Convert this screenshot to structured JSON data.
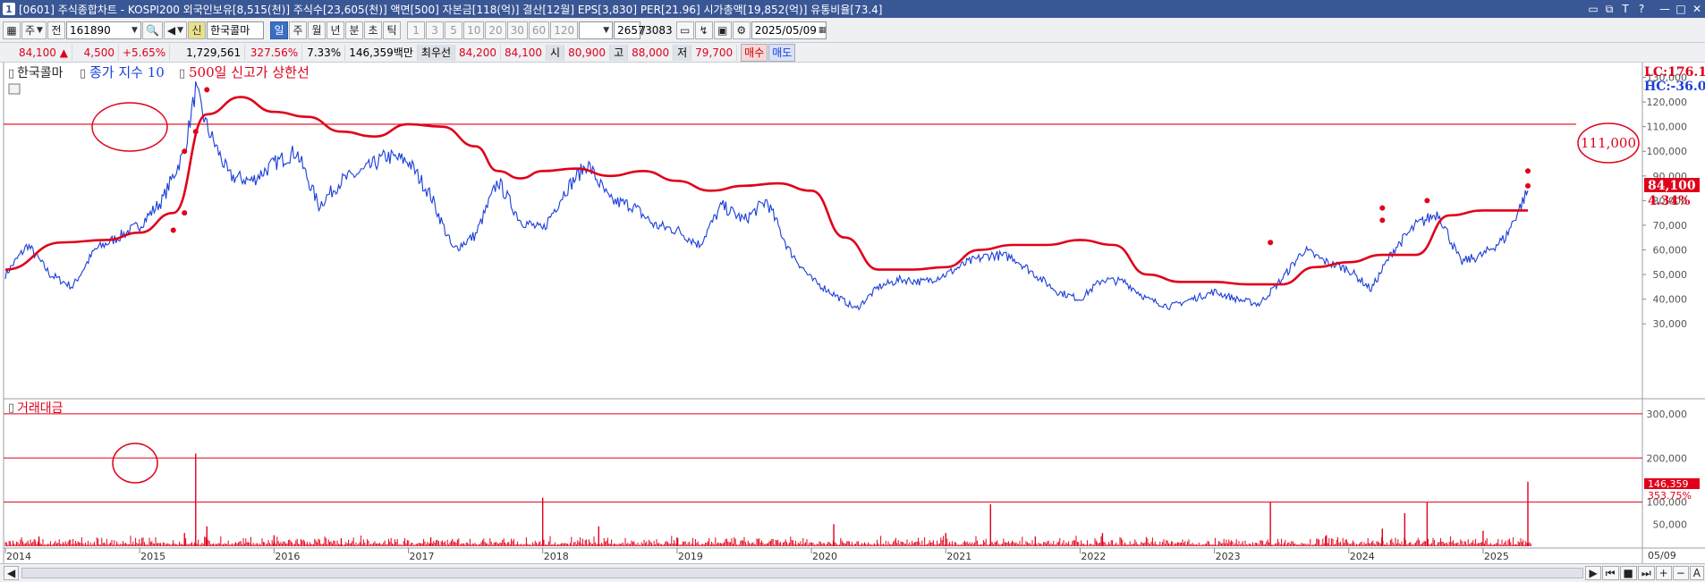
{
  "window": {
    "title": "[0601] 주식종합차트 - KOSPI200 외국인보유[8,515(천)] 주식수[23,605(천)] 액면[500] 자본금[118(억)] 결산[12월] EPS[3,830] PER[21.96] 시가총액[19,852(억)] 유통비율[73.4]",
    "badge": "1",
    "controls": [
      "▭",
      "⧉",
      "T",
      "?",
      "—",
      "□",
      "✕"
    ]
  },
  "toolbar": {
    "period_label": "주",
    "jeon_label": "전",
    "code_value": "161890",
    "name_label": "한국콜마",
    "sin_badge": "신",
    "periods": [
      "일",
      "주",
      "월",
      "년",
      "분",
      "초",
      "틱"
    ],
    "active_period": "일",
    "minute_options": [
      "1",
      "3",
      "5",
      "10",
      "20",
      "30",
      "60",
      "120"
    ],
    "count_value": "2657",
    "count_total": "/3083",
    "date_value": "2025/05/09"
  },
  "quote": {
    "price": "84,100",
    "change_arrow": "▲",
    "change": "4,500",
    "change_pct": "+5.65%",
    "volume": "1,729,561",
    "volume_ratio": "327.56%",
    "turnover": "7.33%",
    "amount": "146,359백만",
    "prior_label": "최우선",
    "prior_ask": "84,200",
    "prior_bid": "84,100",
    "open_label": "시",
    "open": "80,900",
    "high_label": "고",
    "high": "88,000",
    "low_label": "저",
    "low": "79,700",
    "buy_label": "매수",
    "sell_label": "매도"
  },
  "price_pane": {
    "legend": {
      "name": "한국콜마",
      "close_label": "종가 지수 10",
      "line_label": "500일 신고가 상한선"
    },
    "lc_label": "LC:176.1",
    "hc_label": "HC:-36.0",
    "last_price_label": "84,100",
    "last_change_label": "4.34%",
    "circle_annotation_label": "111,000",
    "yticks": [
      "30,000",
      "40,000",
      "50,000",
      "60,000",
      "70,000",
      "80,000",
      "90,000",
      "100,000",
      "110,000",
      "120,000",
      "130,000"
    ]
  },
  "volume_pane": {
    "legend": "거래대금",
    "yticks": [
      "50,000",
      "100,000",
      "200,000",
      "300,000"
    ],
    "last_value_label": "146,359",
    "last_pct_label": "353.75%"
  },
  "x_axis": {
    "labels": [
      "2014",
      "2015",
      "2016",
      "2017",
      "2018",
      "2019",
      "2020",
      "2021",
      "2022",
      "2023",
      "2024",
      "2025"
    ],
    "end_label": "05/09"
  },
  "colors": {
    "price_line": "#1a3ed8",
    "upper_line": "#e0001a",
    "volume_bars": "#e0001a",
    "title_bar": "#3a5795"
  },
  "chart_data": [
    {
      "type": "line",
      "title": "",
      "series": [
        {
          "name": "종가 지수 10",
          "x": [
            "2014-01",
            "2014-03",
            "2014-05",
            "2014-07",
            "2014-09",
            "2014-11",
            "2015-01",
            "2015-03",
            "2015-05",
            "2015-06",
            "2015-07",
            "2015-09",
            "2015-11",
            "2016-01",
            "2016-03",
            "2016-05",
            "2016-07",
            "2016-09",
            "2016-11",
            "2017-01",
            "2017-03",
            "2017-05",
            "2017-07",
            "2017-09",
            "2017-11",
            "2018-01",
            "2018-03",
            "2018-05",
            "2018-07",
            "2018-09",
            "2018-11",
            "2019-01",
            "2019-03",
            "2019-05",
            "2019-07",
            "2019-09",
            "2019-11",
            "2020-01",
            "2020-03",
            "2020-05",
            "2020-07",
            "2020-09",
            "2020-11",
            "2021-01",
            "2021-03",
            "2021-05",
            "2021-07",
            "2021-09",
            "2021-11",
            "2022-01",
            "2022-03",
            "2022-05",
            "2022-07",
            "2022-09",
            "2022-11",
            "2023-01",
            "2023-03",
            "2023-05",
            "2023-07",
            "2023-09",
            "2023-11",
            "2024-01",
            "2024-03",
            "2024-05",
            "2024-07",
            "2024-09",
            "2024-11",
            "2025-01",
            "2025-03",
            "2025-05"
          ],
          "values": [
            50000,
            62000,
            50000,
            45000,
            60000,
            65000,
            70000,
            80000,
            100000,
            125000,
            110000,
            90000,
            88000,
            95000,
            100000,
            78000,
            88000,
            92000,
            98000,
            96000,
            82000,
            60000,
            66000,
            88000,
            72000,
            68000,
            84000,
            95000,
            80000,
            78000,
            70000,
            68000,
            62000,
            78000,
            72000,
            80000,
            60000,
            48000,
            42000,
            36000,
            45000,
            48000,
            47000,
            50000,
            55000,
            58000,
            57000,
            50000,
            43000,
            40000,
            48000,
            47000,
            40000,
            37000,
            40000,
            43000,
            40000,
            38000,
            48000,
            60000,
            55000,
            52000,
            44000,
            60000,
            70000,
            75000,
            55000,
            58000,
            65000,
            84100
          ]
        },
        {
          "name": "500일 신고가 상한선",
          "x": [
            "2014-01",
            "2014-06",
            "2014-10",
            "2015-01",
            "2015-04",
            "2015-07",
            "2015-10",
            "2016-01",
            "2016-04",
            "2016-07",
            "2016-10",
            "2017-01",
            "2017-04",
            "2017-07",
            "2017-09",
            "2017-11",
            "2018-01",
            "2018-04",
            "2018-07",
            "2018-10",
            "2019-01",
            "2019-04",
            "2019-07",
            "2019-10",
            "2020-01",
            "2020-04",
            "2020-07",
            "2020-10",
            "2021-01",
            "2021-04",
            "2021-07",
            "2021-10",
            "2022-01",
            "2022-04",
            "2022-07",
            "2022-10",
            "2023-01",
            "2023-04",
            "2023-07",
            "2023-10",
            "2024-01",
            "2024-04",
            "2024-07",
            "2024-10",
            "2025-01",
            "2025-05"
          ],
          "values": [
            52000,
            63000,
            64000,
            67000,
            75000,
            115000,
            122000,
            116000,
            114000,
            108000,
            106000,
            111000,
            110000,
            102000,
            92000,
            89000,
            92000,
            93000,
            90000,
            92000,
            88000,
            84000,
            86000,
            87000,
            84000,
            65000,
            52000,
            52000,
            53000,
            60000,
            62000,
            62000,
            64000,
            62000,
            50000,
            47000,
            47000,
            46000,
            46000,
            53000,
            55000,
            58000,
            58000,
            74000,
            76000,
            76000
          ]
        }
      ],
      "reference_lines": [
        111000
      ],
      "ylim": [
        25000,
        136000
      ],
      "grid": false,
      "legend": "top-left"
    },
    {
      "type": "bar",
      "title": "거래대금",
      "series": [
        {
          "name": "거래대금",
          "x": [
            "2014-04",
            "2015-05",
            "2015-06",
            "2015-07",
            "2016-01",
            "2016-07",
            "2017-03",
            "2018-01",
            "2018-06",
            "2019-01",
            "2020-03",
            "2021-01",
            "2021-05",
            "2021-09",
            "2022-03",
            "2023-06",
            "2023-11",
            "2024-04",
            "2024-06",
            "2024-08",
            "2025-01",
            "2025-05"
          ],
          "values": [
            22000,
            30000,
            210000,
            45000,
            25000,
            18000,
            20000,
            110000,
            45000,
            20000,
            50000,
            30000,
            95000,
            22000,
            30000,
            100000,
            25000,
            40000,
            75000,
            100000,
            35000,
            146359
          ]
        }
      ],
      "reference_lines": [
        100000,
        200000,
        300000
      ],
      "ylim": [
        0,
        320000
      ],
      "grid": false,
      "legend": "top-left"
    }
  ]
}
